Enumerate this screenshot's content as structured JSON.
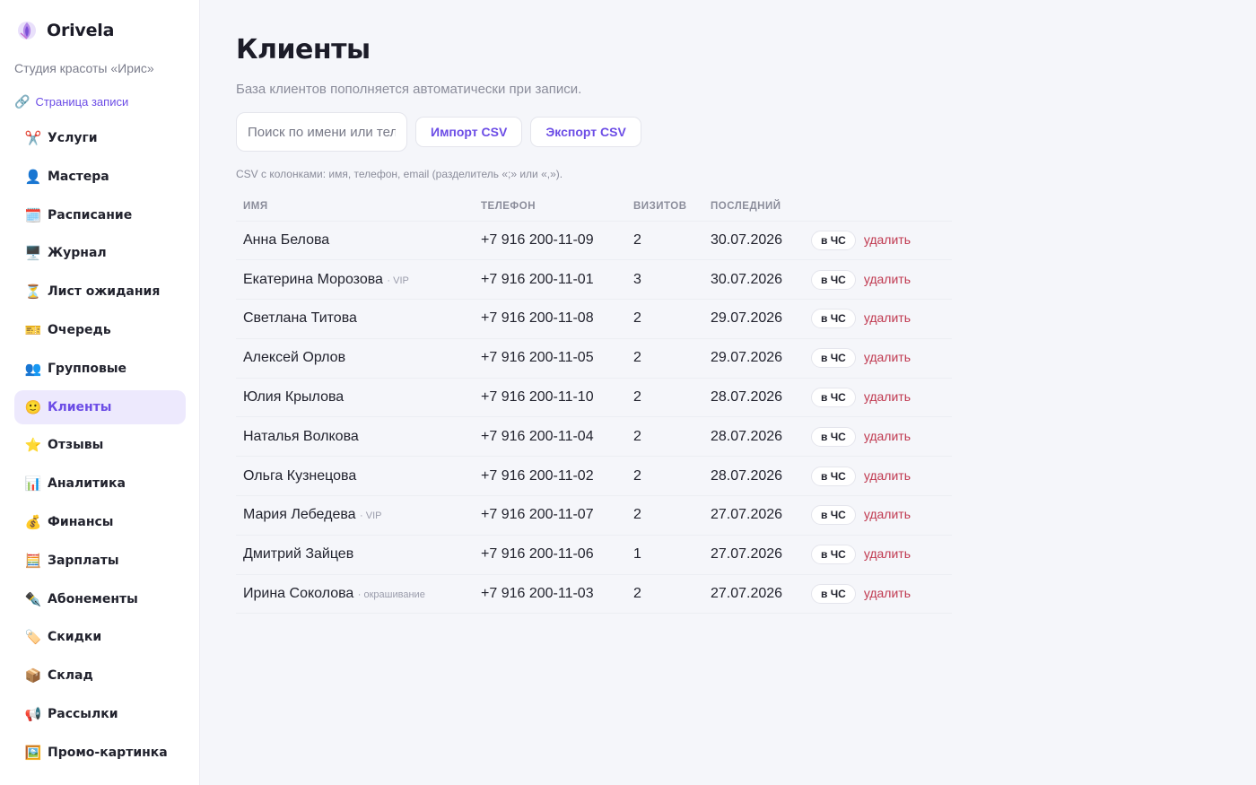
{
  "app": {
    "name": "Orivela",
    "studio": "Студия красоты «Ирис»",
    "booking_link": "Страница записи"
  },
  "nav": [
    {
      "icon": "scissors-icon",
      "glyph": "✂️",
      "label": "Услуги"
    },
    {
      "icon": "person-icon",
      "glyph": "👤",
      "label": "Мастера"
    },
    {
      "icon": "calendar-icon",
      "glyph": "🗓️",
      "label": "Расписание"
    },
    {
      "icon": "monitor-icon",
      "glyph": "🖥️",
      "label": "Журнал"
    },
    {
      "icon": "hourglass-icon",
      "glyph": "⏳",
      "label": "Лист ожидания"
    },
    {
      "icon": "ticket-icon",
      "glyph": "🎫",
      "label": "Очередь"
    },
    {
      "icon": "group-icon",
      "glyph": "👥",
      "label": "Групповые"
    },
    {
      "icon": "face-icon",
      "glyph": "🙂",
      "label": "Клиенты",
      "active": true
    },
    {
      "icon": "star-icon",
      "glyph": "⭐",
      "label": "Отзывы"
    },
    {
      "icon": "bar-chart-icon",
      "glyph": "📊",
      "label": "Аналитика"
    },
    {
      "icon": "money-bag-icon",
      "glyph": "💰",
      "label": "Финансы"
    },
    {
      "icon": "abacus-icon",
      "glyph": "🧮",
      "label": "Зарплаты"
    },
    {
      "icon": "pen-icon",
      "glyph": "✒️",
      "label": "Абонементы"
    },
    {
      "icon": "label-icon",
      "glyph": "🏷️",
      "label": "Скидки"
    },
    {
      "icon": "box-icon",
      "glyph": "📦",
      "label": "Склад"
    },
    {
      "icon": "megaphone-icon",
      "glyph": "📢",
      "label": "Рассылки"
    },
    {
      "icon": "picture-icon",
      "glyph": "🖼️",
      "label": "Промо-картинка"
    }
  ],
  "page": {
    "title": "Клиенты",
    "subtitle": "База клиентов пополняется автоматически при записи.",
    "search_placeholder": "Поиск по имени или телефону",
    "import_label": "Импорт CSV",
    "export_label": "Экспорт CSV",
    "hint": "CSV с колонками: имя, телефон, email (разделитель «;» или «,»)."
  },
  "table": {
    "headers": {
      "name": "ИМЯ",
      "phone": "ТЕЛЕФОН",
      "visits": "ВИЗИТОВ",
      "last": "ПОСЛЕДНИЙ"
    },
    "badge_label": "в ЧС",
    "delete_label": "удалить",
    "rows": [
      {
        "name": "Анна Белова",
        "tag": "",
        "phone": "+7 916 200-11-09",
        "visits": "2",
        "last": "30.07.2026"
      },
      {
        "name": "Екатерина Морозова",
        "tag": "· VIP",
        "phone": "+7 916 200-11-01",
        "visits": "3",
        "last": "30.07.2026"
      },
      {
        "name": "Светлана Титова",
        "tag": "",
        "phone": "+7 916 200-11-08",
        "visits": "2",
        "last": "29.07.2026"
      },
      {
        "name": "Алексей Орлов",
        "tag": "",
        "phone": "+7 916 200-11-05",
        "visits": "2",
        "last": "29.07.2026"
      },
      {
        "name": "Юлия Крылова",
        "tag": "",
        "phone": "+7 916 200-11-10",
        "visits": "2",
        "last": "28.07.2026"
      },
      {
        "name": "Наталья Волкова",
        "tag": "",
        "phone": "+7 916 200-11-04",
        "visits": "2",
        "last": "28.07.2026"
      },
      {
        "name": "Ольга Кузнецова",
        "tag": "",
        "phone": "+7 916 200-11-02",
        "visits": "2",
        "last": "28.07.2026"
      },
      {
        "name": "Мария Лебедева",
        "tag": "· VIP",
        "phone": "+7 916 200-11-07",
        "visits": "2",
        "last": "27.07.2026"
      },
      {
        "name": "Дмитрий Зайцев",
        "tag": "",
        "phone": "+7 916 200-11-06",
        "visits": "1",
        "last": "27.07.2026"
      },
      {
        "name": "Ирина Соколова",
        "tag": "· окрашивание",
        "phone": "+7 916 200-11-03",
        "visits": "2",
        "last": "27.07.2026"
      }
    ]
  },
  "colors": {
    "accent": "#6c4de6",
    "active_bg": "#ede9fd",
    "danger": "#c0384f"
  }
}
